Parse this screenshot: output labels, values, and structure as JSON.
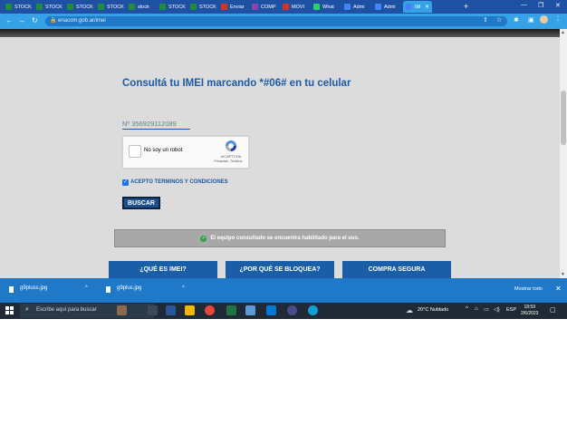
{
  "browser": {
    "tabs": [
      {
        "label": "STOCK",
        "color": "#1e8e3e"
      },
      {
        "label": "STOCK",
        "color": "#1e8e3e"
      },
      {
        "label": "STOCK",
        "color": "#1e8e3e"
      },
      {
        "label": "STOCK",
        "color": "#1e8e3e"
      },
      {
        "label": "stock",
        "color": "#1e8e3e"
      },
      {
        "label": "STOCK",
        "color": "#1e8e3e"
      },
      {
        "label": "STOCK",
        "color": "#1e8e3e"
      },
      {
        "label": "Enviar",
        "color": "#d93025"
      },
      {
        "label": "COMP",
        "color": "#8e44ad"
      },
      {
        "label": "MOVI",
        "color": "#d93025"
      },
      {
        "label": "What",
        "color": "#25d366"
      },
      {
        "label": "Admi",
        "color": "#4285f4"
      },
      {
        "label": "Admi",
        "color": "#4285f4"
      },
      {
        "label": "IM",
        "color": "#4285f4",
        "active": true
      }
    ],
    "new_tab": "+",
    "url": "enacom.gob.ar/imei"
  },
  "page": {
    "title": "Consultá tu IMEI marcando *#06# en tu celular",
    "imei_value": "Nº 356929112089",
    "recaptcha": {
      "label": "No soy un robot",
      "brand": "reCAPTCHA",
      "links": "Privacidad - Términos"
    },
    "terms_label": "ACEPTO TERMINOS Y CONDICIONES",
    "search_button": "BUSCAR",
    "result_text": "El equipo consultado se encuentra habilitado para el uso.",
    "buttons": [
      {
        "label": "¿QUÉ ES IMEI?"
      },
      {
        "label": "¿POR QUÉ SE BLOQUEA?"
      },
      {
        "label": "COMPRA SEGURA"
      }
    ]
  },
  "downloads": {
    "items": [
      {
        "name": "g9pluss.jpg"
      },
      {
        "name": "g9plus.jpg"
      }
    ],
    "show_all": "Mostrar todo"
  },
  "taskbar": {
    "search_placeholder": "Escribe aquí para buscar",
    "weather": "20°C  Nublado",
    "language": "ESP",
    "time": "18:59",
    "date": "2/6/2023"
  },
  "colors": {
    "accent": "#1d5aa6",
    "chrome_blue": "#35a1e6",
    "success": "#2ea44f"
  }
}
